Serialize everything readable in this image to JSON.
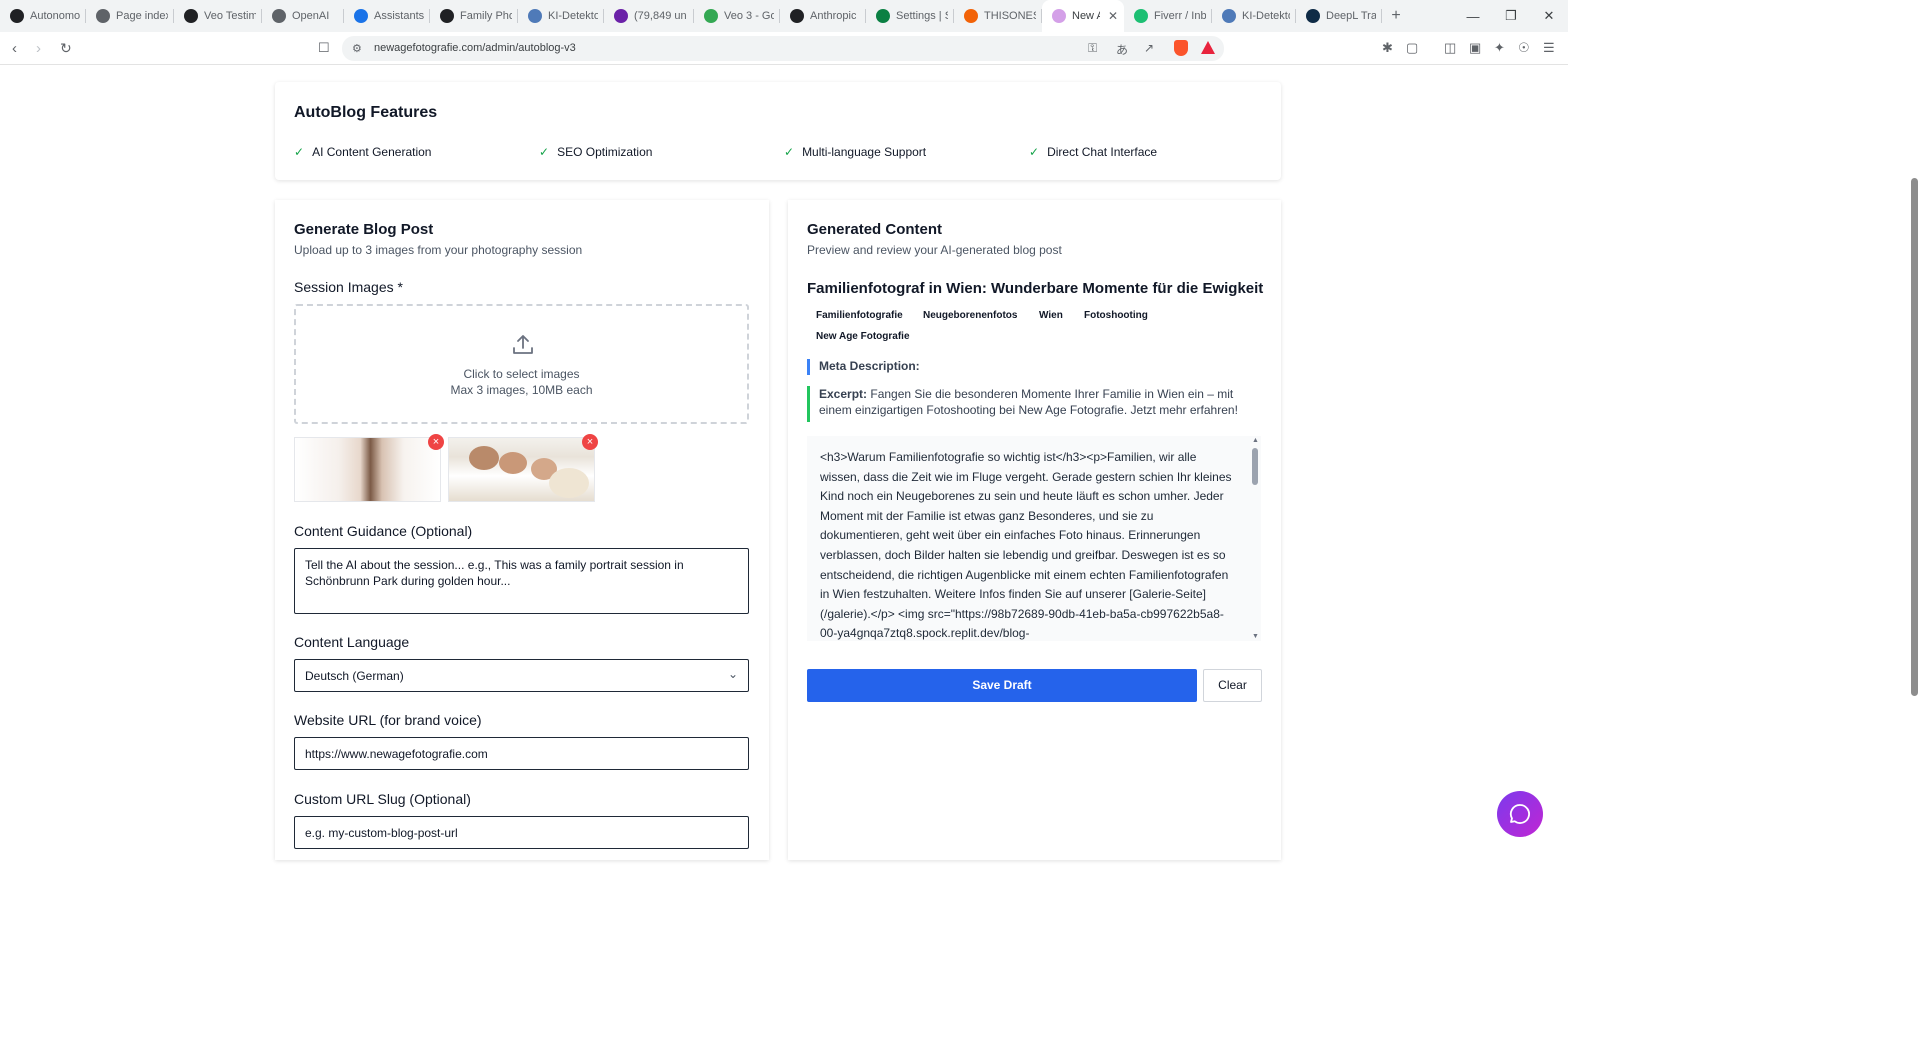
{
  "browser": {
    "tabs": [
      {
        "label": "Autonomo",
        "icon": "openai-icon",
        "color": "#202124"
      },
      {
        "label": "Page index",
        "icon": "page-index-icon",
        "color": "#5f6368"
      },
      {
        "label": "Veo Testim",
        "icon": "openai-icon",
        "color": "#202124"
      },
      {
        "label": "OpenAI",
        "icon": "openai-icon",
        "color": "#5f6368"
      },
      {
        "label": "Assistants",
        "icon": "globe-icon",
        "color": "#1a73e8"
      },
      {
        "label": "Family Pho",
        "icon": "openai-icon",
        "color": "#202124"
      },
      {
        "label": "KI-Detekto",
        "icon": "detector-icon",
        "color": "#4f7ab8"
      },
      {
        "label": "(79,849 un",
        "icon": "mail-icon",
        "color": "#6b21a8"
      },
      {
        "label": "Veo 3 - Go",
        "icon": "drive-icon",
        "color": "#34a853"
      },
      {
        "label": "Anthropic",
        "icon": "anthropic-icon",
        "color": "#202124"
      },
      {
        "label": "Settings | S",
        "icon": "settings-icon",
        "color": "#0b8043"
      },
      {
        "label": "THISONES",
        "icon": "replit-icon",
        "color": "#f26207"
      },
      {
        "label": "New A",
        "icon": "new-tab-icon",
        "color": "#d4a0e8"
      },
      {
        "label": "Fiverr / Inb",
        "icon": "fiverr-icon",
        "color": "#1dbf73"
      },
      {
        "label": "KI-Detekto",
        "icon": "detector-icon",
        "color": "#4f7ab8"
      },
      {
        "label": "DeepL Tra",
        "icon": "deepl-icon",
        "color": "#0f2b46"
      }
    ],
    "active_tab_close": "✕",
    "new_tab": "+",
    "window_controls": {
      "minimize": "—",
      "restore": "❐",
      "close": "✕"
    },
    "url": "newagefotografie.com/admin/autoblog-v3"
  },
  "features": {
    "title": "AutoBlog Features",
    "items": [
      "AI Content Generation",
      "SEO Optimization",
      "Multi-language Support",
      "Direct Chat Interface"
    ]
  },
  "generate": {
    "title": "Generate Blog Post",
    "subtitle": "Upload up to 3 images from your photography session",
    "images_label": "Session Images *",
    "dropzone_line1": "Click to select images",
    "dropzone_line2": "Max 3 images, 10MB each",
    "remove_label": "×",
    "guidance_label": "Content Guidance (Optional)",
    "guidance_placeholder": "Tell the AI about the session... e.g., This was a family portrait session in Schönbrunn Park during golden hour...",
    "language_label": "Content Language",
    "language_value": "Deutsch (German)",
    "website_label": "Website URL (for brand voice)",
    "website_value": "https://www.newagefotografie.com",
    "slug_label": "Custom URL Slug (Optional)",
    "slug_placeholder": "e.g. my-custom-blog-post-url"
  },
  "generated": {
    "title": "Generated Content",
    "subtitle": "Preview and review your AI-generated blog post",
    "post_title": "Familienfotograf in Wien: Wunderbare Momente für die Ewigkeit",
    "tags": [
      "Familienfotografie",
      "Neugeborenenfotos",
      "Wien",
      "Fotoshooting",
      "New Age Fotografie"
    ],
    "meta_label": "Meta Description:",
    "excerpt_label": "Excerpt:",
    "excerpt_text": "Fangen Sie die besonderen Momente Ihrer Familie in Wien ein – mit einem einzigartigen Fotoshooting bei New Age Fotografie. Jetzt mehr erfahren!",
    "content": "<h3>Warum Familienfotografie so wichtig ist</h3><p>Familien, wir alle wissen, dass die Zeit wie im Fluge vergeht. Gerade gestern schien Ihr kleines Kind noch ein Neugeborenes zu sein und heute läuft es schon umher. Jeder Moment mit der Familie ist etwas ganz Besonderes, und sie zu dokumentieren, geht weit über ein einfaches Foto hinaus. Erinnerungen verblassen, doch Bilder halten sie lebendig und greifbar. Deswegen ist es so entscheidend, die richtigen Augenblicke mit einem echten Familienfotografen in Wien festzuhalten. Weitere Infos finden Sie auf unserer [Galerie-Seite](/galerie).</p> <img src=\"https://98b72689-90db-41eb-ba5a-cb997622b5a8-00-ya4gnqa7ztq8.spock.replit.dev/blog-",
    "save_label": "Save Draft",
    "clear_label": "Clear"
  },
  "colors": {
    "primary": "#2563eb",
    "check": "#16a34a",
    "meta_border": "#3b82f6",
    "excerpt_border": "#22c55e",
    "remove": "#ef4444"
  }
}
